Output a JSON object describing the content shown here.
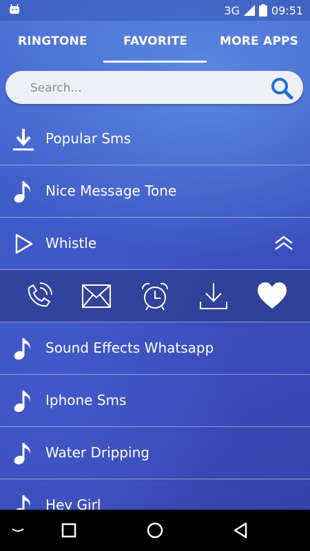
{
  "status_bar": {
    "network": "3G",
    "time": "09:51",
    "left_icon": "android-debug-icon"
  },
  "tabs": [
    {
      "label": "RINGTONE",
      "selected": false
    },
    {
      "label": "FAVORITE",
      "selected": true
    },
    {
      "label": "MORE APPS",
      "selected": false
    }
  ],
  "search": {
    "placeholder": "Search...",
    "value": ""
  },
  "list": {
    "items": [
      {
        "label": "Popular Sms",
        "icon": "download-icon"
      },
      {
        "label": "Nice Message Tone",
        "icon": "music-note-icon"
      },
      {
        "label": "Whistle",
        "icon": "play-icon",
        "expanded": true
      },
      {
        "label": "Sound Effects Whatsapp",
        "icon": "music-note-icon"
      },
      {
        "label": "Iphone Sms",
        "icon": "music-note-icon"
      },
      {
        "label": "Water Dripping",
        "icon": "music-note-icon"
      },
      {
        "label": "Hey Girl",
        "icon": "music-note-icon"
      }
    ],
    "expanded_actions": [
      {
        "name": "set-call-ringtone",
        "icon": "phone-ringing-icon"
      },
      {
        "name": "set-sms-tone",
        "icon": "envelope-icon"
      },
      {
        "name": "set-alarm-tone",
        "icon": "alarm-clock-icon"
      },
      {
        "name": "download",
        "icon": "download-icon"
      },
      {
        "name": "favorite",
        "icon": "heart-icon",
        "active": true
      }
    ]
  },
  "nav_bar": [
    "keyboard-hide-icon",
    "recents-icon",
    "home-icon",
    "back-icon"
  ],
  "colors": {
    "accent": "#ffffff",
    "background": "#3f56c4",
    "search_bg": "#eef0f5",
    "search_icon": "#1f6fd6"
  }
}
